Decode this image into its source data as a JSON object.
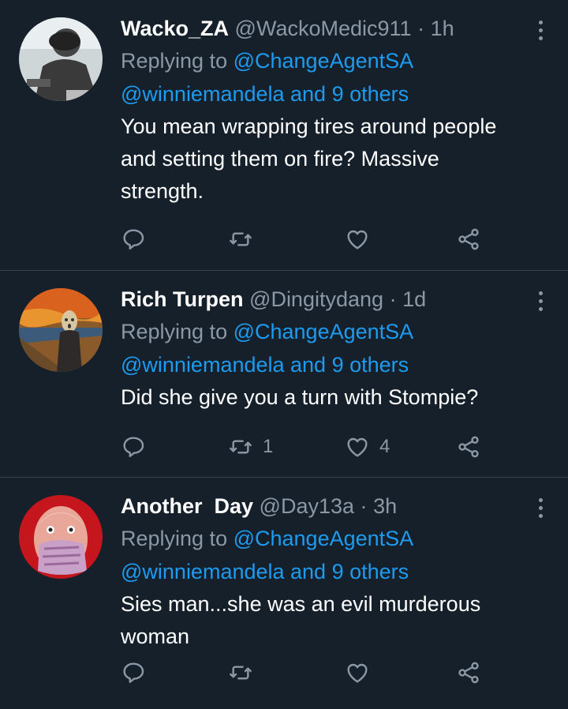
{
  "tweets": [
    {
      "name": "Wacko_ZA",
      "handle": "@WackoMedic911",
      "sep": "·",
      "time": "1h",
      "replying_prefix": "Replying to ",
      "replying_to": "@ChangeAgentSA",
      "replying_others": "@winniemandela and 9 others",
      "text": "You mean wrapping tires around people and setting them on fire? Massive strength.",
      "retweets": "",
      "likes": ""
    },
    {
      "name": "Rich Turpen",
      "handle": "@Dingitydang",
      "sep": "·",
      "time": "1d",
      "replying_prefix": "Replying to ",
      "replying_to": "@ChangeAgentSA",
      "replying_others": "@winniemandela and 9 others",
      "text": "Did she give you a turn with Stompie?",
      "retweets": "1",
      "likes": "4"
    },
    {
      "name": "Another  Day",
      "handle": "@Day13a",
      "sep": "·",
      "time": "3h",
      "replying_prefix": "Replying to ",
      "replying_to": "@ChangeAgentSA",
      "replying_others": "@winniemandela and 9 others",
      "text": "Sies man...she was an evil murderous woman",
      "retweets": "",
      "likes": ""
    }
  ],
  "icons": {
    "reply": "reply-icon",
    "retweet": "retweet-icon",
    "like": "heart-icon",
    "share": "share-icon",
    "more": "more-options-icon"
  },
  "colors": {
    "background": "#15202b",
    "link": "#1d9bf0",
    "secondary_text": "#8b98a5",
    "divider": "#38444d"
  }
}
